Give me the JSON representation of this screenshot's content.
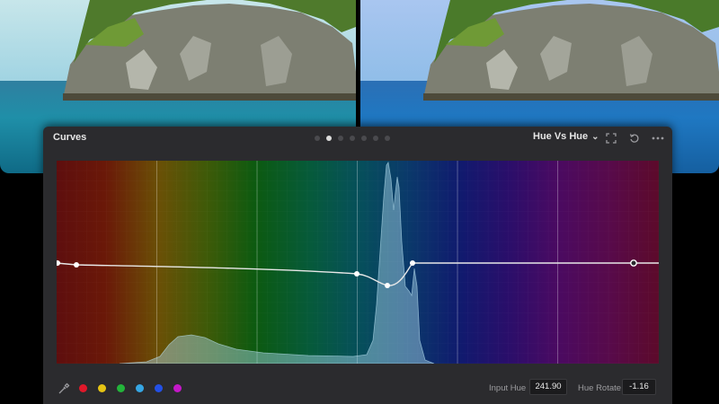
{
  "panel": {
    "title": "Curves",
    "page_dots": 7,
    "active_dot": 1,
    "mode_label": "Hue Vs Hue",
    "icons": [
      "expand-icon",
      "reset-icon",
      "more-icon"
    ]
  },
  "swatches": [
    {
      "name": "red",
      "color": "#e0182a"
    },
    {
      "name": "yellow",
      "color": "#e6c414"
    },
    {
      "name": "green",
      "color": "#23b43a"
    },
    {
      "name": "cyan",
      "color": "#36a6e4"
    },
    {
      "name": "blue",
      "color": "#2350e6"
    },
    {
      "name": "magenta",
      "color": "#c418c8"
    }
  ],
  "footer": {
    "input_hue_label": "Input Hue",
    "input_hue_value": "241.90",
    "hue_rotate_label": "Hue Rotate",
    "hue_rotate_value": "-1.16"
  },
  "colors": {
    "panel_bg": "#2b2b2e",
    "curve": "#e8e8e8",
    "histogram": "#9fd4e8"
  }
}
